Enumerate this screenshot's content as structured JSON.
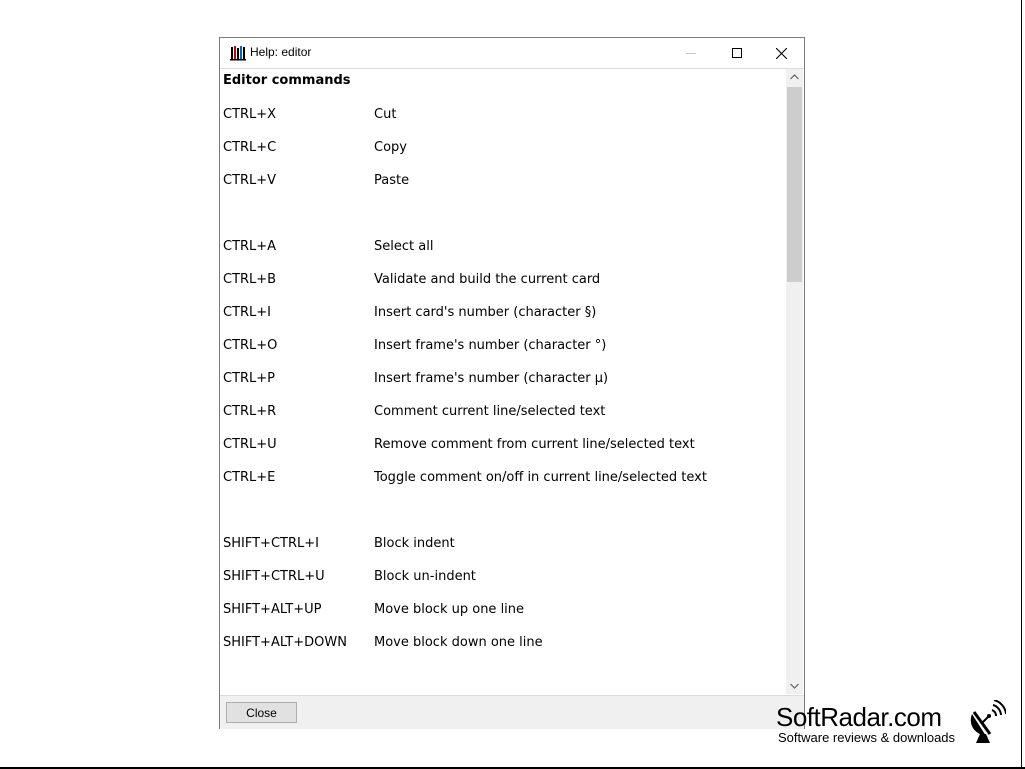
{
  "window": {
    "title": "Help: editor",
    "icon": "editor-app-icon"
  },
  "content": {
    "heading": "Editor commands",
    "commands": [
      {
        "key": "CTRL+X",
        "desc": "Cut"
      },
      {
        "key": "CTRL+C",
        "desc": "Copy"
      },
      {
        "key": "CTRL+V",
        "desc": "Paste"
      },
      {
        "key": "CTRL+A",
        "desc": "Select all"
      },
      {
        "key": "CTRL+B",
        "desc": "Validate and build the current card"
      },
      {
        "key": "CTRL+I",
        "desc": "Insert card's number (character §)"
      },
      {
        "key": "CTRL+O",
        "desc": "Insert frame's number (character °)"
      },
      {
        "key": "CTRL+P",
        "desc": "Insert frame's number (character µ)"
      },
      {
        "key": "CTRL+R",
        "desc": "Comment current line/selected text"
      },
      {
        "key": "CTRL+U",
        "desc": "Remove comment from current line/selected text"
      },
      {
        "key": "CTRL+E",
        "desc": "Toggle comment on/off in current line/selected text"
      },
      {
        "key": "SHIFT+CTRL+I",
        "desc": "Block indent"
      },
      {
        "key": "SHIFT+CTRL+U",
        "desc": "Block un-indent"
      },
      {
        "key": "SHIFT+ALT+UP",
        "desc": "Move block up one line"
      },
      {
        "key": "SHIFT+ALT+DOWN",
        "desc": "Move block down one line"
      }
    ]
  },
  "footer": {
    "close_label": "Close"
  },
  "watermark": {
    "title": "SoftRadar.com",
    "subtitle": "Software reviews & downloads",
    "icon": "satellite-dish-icon"
  }
}
